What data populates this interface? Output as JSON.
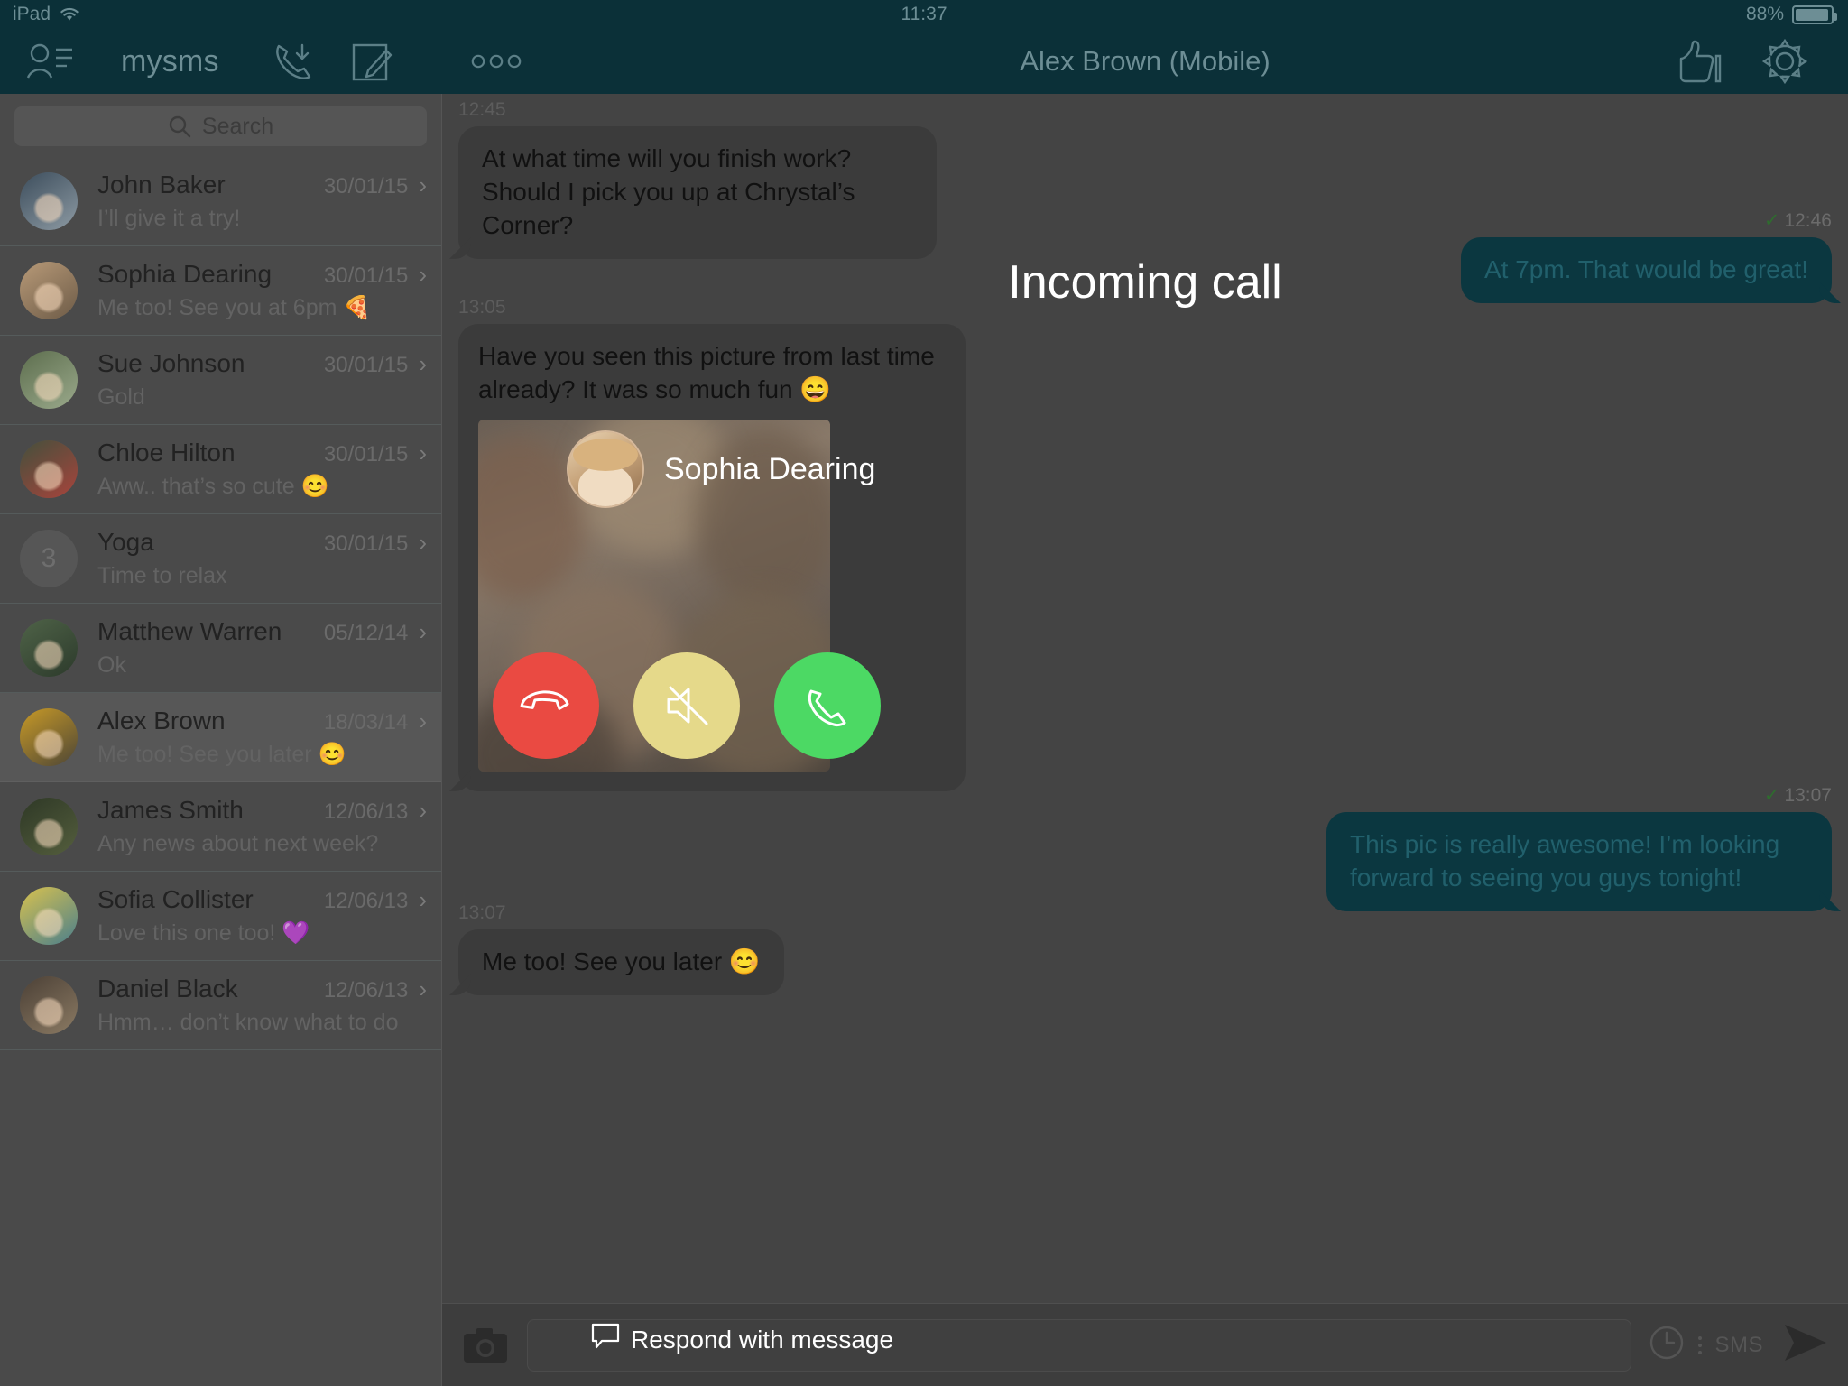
{
  "status_bar": {
    "device": "iPad",
    "wifi_icon": "wifi-icon",
    "time": "11:37",
    "battery_percent": "88%",
    "battery_icon": "battery-icon"
  },
  "nav": {
    "contacts_icon": "contacts-icon",
    "app_title": "mysms",
    "call_log_icon": "incoming-call-icon",
    "compose_icon": "compose-icon",
    "more_icon": "more-dots-icon",
    "chat_title": "Alex Brown (Mobile)",
    "thumbs_up_icon": "thumbs-up-icon",
    "settings_icon": "gear-icon"
  },
  "sidebar": {
    "search": {
      "placeholder": "Search",
      "icon": "search-icon",
      "value": ""
    },
    "conversations": [
      {
        "name": "John Baker",
        "date": "30/01/15",
        "preview": "I’ll give it a try!",
        "avatar_kind": "photo",
        "badge": "",
        "selected": false,
        "av1": "#3c4d5c",
        "av2": "#8d9aa3"
      },
      {
        "name": "Sophia Dearing",
        "date": "30/01/15",
        "preview": "Me too! See you at 6pm 🍕",
        "avatar_kind": "photo",
        "badge": "",
        "selected": false,
        "av1": "#b89a78",
        "av2": "#6d5b47"
      },
      {
        "name": "Sue Johnson",
        "date": "30/01/15",
        "preview": "Gold",
        "avatar_kind": "photo",
        "badge": "",
        "selected": false,
        "av1": "#5d6e4e",
        "av2": "#9aa98b"
      },
      {
        "name": "Chloe Hilton",
        "date": "30/01/15",
        "preview": "Aww.. that’s so cute 😊",
        "avatar_kind": "photo",
        "badge": "",
        "selected": false,
        "av1": "#43503c",
        "av2": "#a8443c"
      },
      {
        "name": "Yoga",
        "date": "30/01/15",
        "preview": "Time to relax",
        "avatar_kind": "badge",
        "badge": "3",
        "selected": false,
        "av1": "#565656",
        "av2": "#565656"
      },
      {
        "name": "Matthew Warren",
        "date": "05/12/14",
        "preview": "Ok",
        "avatar_kind": "photo",
        "badge": "",
        "selected": false,
        "av1": "#4f6348",
        "av2": "#2c3a2b"
      },
      {
        "name": "Alex Brown",
        "date": "18/03/14",
        "preview": "Me too! See you later 😊",
        "avatar_kind": "photo",
        "badge": "",
        "selected": true,
        "av1": "#c89a27",
        "av2": "#4d4636"
      },
      {
        "name": "James Smith",
        "date": "12/06/13",
        "preview": "Any news about next week?",
        "avatar_kind": "photo",
        "badge": "",
        "selected": false,
        "av1": "#2e3826",
        "av2": "#545e3d"
      },
      {
        "name": "Sofia Collister",
        "date": "12/06/13",
        "preview": "Love this one too! 💜",
        "avatar_kind": "photo",
        "badge": "",
        "selected": false,
        "av1": "#d9c24e",
        "av2": "#4a7f8c"
      },
      {
        "name": "Daniel Black",
        "date": "12/06/13",
        "preview": "Hmm… don’t know what to do",
        "avatar_kind": "photo",
        "badge": "",
        "selected": false,
        "av1": "#4b4036",
        "av2": "#8b7a63"
      }
    ]
  },
  "chat": {
    "messages": [
      {
        "id": "m1",
        "dir": "in",
        "time": "12:45",
        "delivered": false,
        "text": "At what time will you finish work? Should I pick you up at Chrystal’s Corner?"
      },
      {
        "id": "m2",
        "dir": "out",
        "time": "12:46",
        "delivered": true,
        "text": "At 7pm. That would be great!"
      },
      {
        "id": "m3",
        "dir": "in",
        "time": "13:05",
        "delivered": false,
        "text": "Have you seen this picture from last time already? It was so much fun 😄",
        "has_photo": true
      },
      {
        "id": "m4",
        "dir": "out",
        "time": "13:07",
        "delivered": true,
        "text": "This pic is really awesome! I’m looking forward to seeing you guys tonight!"
      },
      {
        "id": "m5",
        "dir": "in",
        "time": "13:07",
        "delivered": false,
        "text": "Me too! See you later 😊"
      }
    ]
  },
  "input_bar": {
    "camera_icon": "camera-icon",
    "message_value": "",
    "message_placeholder": "",
    "schedule_icon": "clock-icon",
    "options_icon": "vertical-dots-icon",
    "send_type": "SMS",
    "send_icon": "send-icon"
  },
  "call_overlay": {
    "title": "Incoming call",
    "caller_name": "Sophia Dearing",
    "caller_avatar": "caller-avatar",
    "decline_icon": "decline-call-icon",
    "mute_icon": "mute-icon",
    "accept_icon": "accept-call-icon",
    "respond_label": "Respond with message",
    "respond_icon": "message-bubble-icon",
    "colors": {
      "decline": "#ea4a42",
      "mute": "#e5d98a",
      "accept": "#4cd964"
    }
  }
}
